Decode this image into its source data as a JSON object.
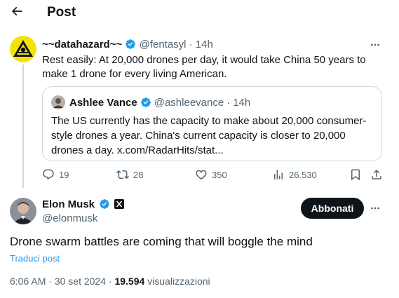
{
  "header": {
    "title": "Post",
    "back_icon": "arrow-left-icon"
  },
  "parent_post": {
    "display_name": "~~datahazard~~",
    "handle": "@fentasyl",
    "separator": "·",
    "time": "14h",
    "text": "Rest easily: At 20,000 drones per day, it would take China 50 years to make 1 drone for every living American.",
    "quote": {
      "display_name": "Ashlee Vance",
      "handle": "@ashleevance",
      "separator": "·",
      "time": "14h",
      "text": "The US currently has the capacity to make about 20,000 consumer-style drones a year. China's current capacity is closer to 20,000 drones a day. x.com/RadarHits/stat..."
    },
    "actions": {
      "replies": "19",
      "reposts": "28",
      "likes": "350",
      "views": "26.530"
    }
  },
  "main_post": {
    "display_name": "Elon Musk",
    "handle": "@elonmusk",
    "follow_label": "Abbonati",
    "text": "Drone swarm battles are coming that will boggle the mind",
    "translate_label": "Traduci post",
    "time": "6:06 AM",
    "separator": "·",
    "date": "30 set 2024",
    "views_count": "19.594",
    "views_label": "visualizzazioni"
  },
  "colors": {
    "accent": "#1d9bf0",
    "text": "#0f1419",
    "muted": "#536471",
    "border": "#cfd9de",
    "verified": "#1d9bf0",
    "hazard_yellow": "#f2e400"
  }
}
